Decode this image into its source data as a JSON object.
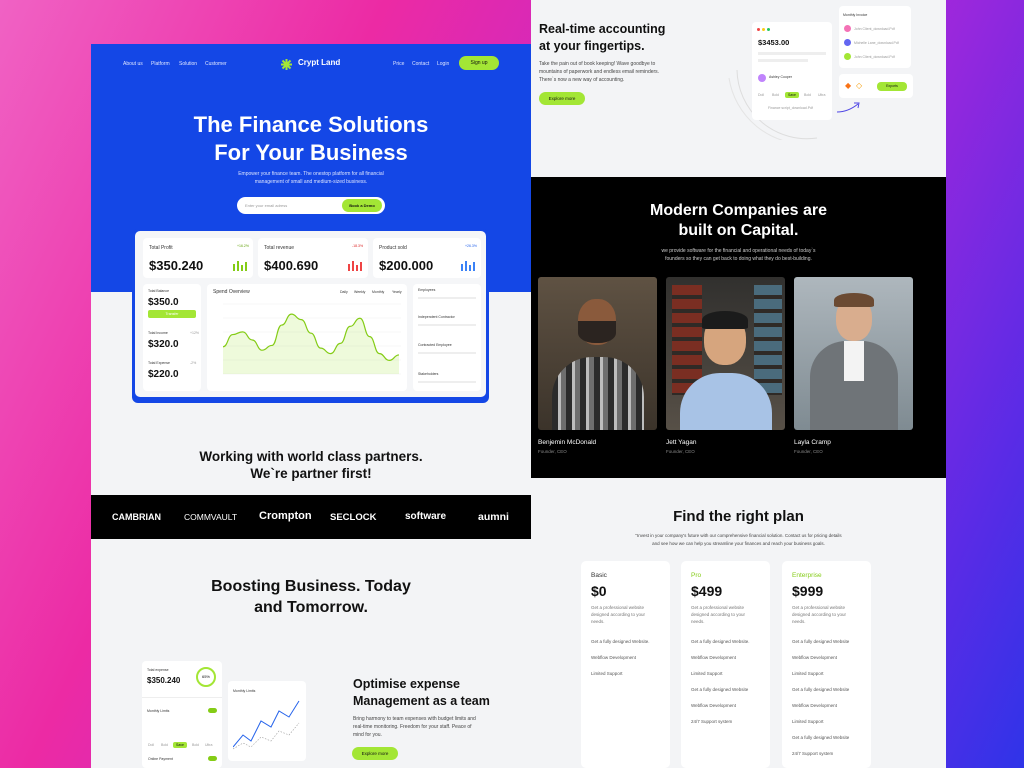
{
  "hero": {
    "nav_left": [
      "About us",
      "Platform",
      "Solution",
      "Customer"
    ],
    "brand": "Crypt Land",
    "nav_right": [
      "Price",
      "Contact",
      "Login"
    ],
    "signup": "Sign up",
    "title_line1": "The Finance Solutions",
    "title_line2": "For Your Business",
    "subtitle_line1": "Empower your finance team. The onestop platform for all financial",
    "subtitle_line2": "management of small and medium-sized business.",
    "email_placeholder": "Enter your email adress",
    "demo_button": "Book a Demo"
  },
  "dashboard": {
    "stats": [
      {
        "label": "Total Profit",
        "value": "$350.240",
        "badge": "+16.2%"
      },
      {
        "label": "Total revenue",
        "value": "$400.690",
        "badge": "-18.3%"
      },
      {
        "label": "Product sold",
        "value": "$200.000",
        "badge": "+26.3%"
      }
    ],
    "balance_label": "Total Balance",
    "balance_value": "$350.0",
    "balance_button": "Transfer",
    "income_label": "Total Income",
    "income_value": "$320.0",
    "income_pct": "+12%",
    "expense_label": "Total Expense",
    "expense_value": "$220.0",
    "expense_pct": "-2%",
    "spend_title": "Spend Overview",
    "spend_tabs": [
      "Daily",
      "Weekly",
      "Monthly",
      "Yearly"
    ],
    "side_items": [
      "Employees",
      "Independent Contractor",
      "Contracted Employee",
      "Stakeholders"
    ]
  },
  "partners": {
    "line1": "Working with world class partners.",
    "line2": "We`re partner first!",
    "logos": [
      "CAMBRIAN",
      "COMMVAULT",
      "Crompton",
      "SECLOCK",
      "software",
      "aumni"
    ]
  },
  "boosting": {
    "line1": "Boosting Business. Today",
    "line2": "and Tomorrow.",
    "mock_expense_label": "Total expense",
    "mock_expense_value": "$350.240",
    "mock_pct": "65%",
    "mock_monthly": "Monthly Limits",
    "mock_chips": [
      "Doll",
      "Bold",
      "Save",
      "Bold",
      "Ultra"
    ],
    "mock_payment": "Online Payment",
    "optimise_line1": "Optimise expense",
    "optimise_line2": "Management as a team",
    "optimise_body": [
      "Bring harmony to team expenses with budget limits and",
      "real-time monitoring. Freedom for your staff. Peace of",
      "mind for you."
    ],
    "explore": "Explore more"
  },
  "realtime": {
    "line1": "Real-time accounting",
    "line2": "at your fingertips.",
    "body": [
      "Take the pain out of book keeping! Wave goodbye to",
      "mountains of paperwork and endless email reminders.",
      "There`s now a new way of accounting."
    ],
    "explore": "Explore more",
    "mock_amount": "$3453.00",
    "mock_name": "Ashley Cooper",
    "mock_chips": [
      "Doll",
      "Bold",
      "Save",
      "Bold",
      "Ultra"
    ],
    "mock_file": "Finance script_download.Pdf",
    "mock_invoice_title": "Monthly Invoice",
    "mock_invoices": [
      "John Client_download.Pdf",
      "Michelle Lane_download.Pdf",
      "John Client_download.Pdf"
    ],
    "mock_export": "Exports"
  },
  "capital": {
    "line1": "Modern Companies are",
    "line2": "built on Capital.",
    "body_line1": "we provide software for the financial and operational needs of today`s",
    "body_line2": "founders so they can get back to doing what they do best-building.",
    "people": [
      {
        "name": "Benjemin McDonald",
        "role": "Founder, CEO"
      },
      {
        "name": "Jett Yagan",
        "role": "Founder, CEO"
      },
      {
        "name": "Layla Cramp",
        "role": "Founder, CEO"
      }
    ]
  },
  "pricing": {
    "title": "Find the right plan",
    "body_line1": "\"Invest in your company's future with our comprehensive financial solution. Contact us for pricing details",
    "body_line2": "and see how we can help you streamline your finances and reach your business goals.",
    "plans": [
      {
        "name": "Basic",
        "price": "$0",
        "desc": [
          "Get a professional website",
          "designed according to your",
          "needs."
        ],
        "features": [
          "Get a fully designed Website.",
          "Webflow Development",
          "Limited Support"
        ]
      },
      {
        "name": "Pro",
        "price": "$499",
        "desc": [
          "Get a professional website",
          "designed according to your",
          "needs."
        ],
        "features": [
          "Get a fully designed Website.",
          "Webflow Development",
          "Limited Support",
          "Get a fully designed Website",
          "Webflow Development",
          "24/7 Support system"
        ]
      },
      {
        "name": "Enterprise",
        "price": "$999",
        "desc": [
          "Get a professional website",
          "designed according to your",
          "needs."
        ],
        "features": [
          "Get a fully designed Website",
          "Webflow Development",
          "Limited Support",
          "Get a fully designed Website",
          "Webflow Development",
          "Limited Support",
          "Get a fully designed Website",
          "24/7 Support system"
        ]
      }
    ]
  },
  "colors": {
    "brand_blue": "#1447e6",
    "lime": "#a3e635",
    "dark": "#000000"
  },
  "spend_chart": {
    "type": "line",
    "values": [
      40,
      58,
      62,
      50,
      35,
      42,
      72,
      88,
      80,
      60,
      38,
      30,
      45,
      70,
      82,
      55,
      30,
      20,
      28
    ]
  }
}
